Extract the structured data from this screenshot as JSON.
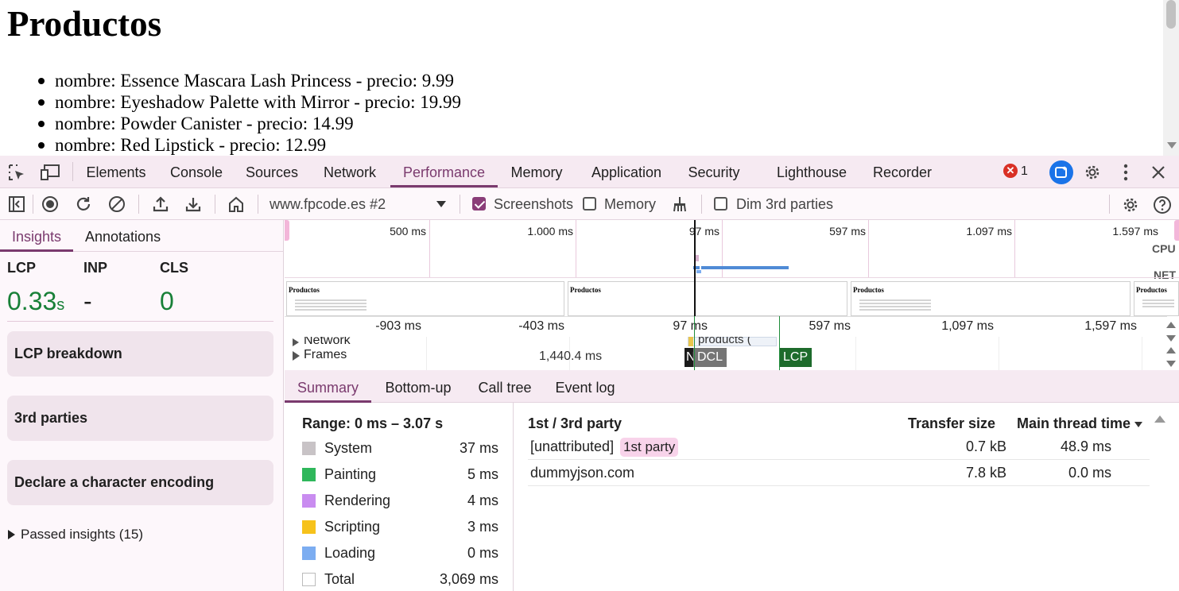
{
  "page": {
    "title": "Productos",
    "items": [
      "nombre: Essence Mascara Lash Princess - precio: 9.99",
      "nombre: Eyeshadow Palette with Mirror - precio: 19.99",
      "nombre: Powder Canister - precio: 14.99",
      "nombre: Red Lipstick - precio: 12.99"
    ]
  },
  "devtools": {
    "tabs": [
      "Elements",
      "Console",
      "Sources",
      "Network",
      "Performance",
      "Memory",
      "Application",
      "Security",
      "Lighthouse",
      "Recorder"
    ],
    "active_tab": "Performance",
    "error_count": "1",
    "toolbar": {
      "target": "www.fpcode.es #2",
      "screenshots_label": "Screenshots",
      "screenshots_checked": true,
      "memory_label": "Memory",
      "memory_checked": false,
      "dim_label": "Dim 3rd parties",
      "dim_checked": false
    }
  },
  "insights": {
    "tabs": [
      "Insights",
      "Annotations"
    ],
    "active_tab": "Insights",
    "metrics": [
      {
        "label": "LCP",
        "value": "0.33",
        "unit": "s",
        "color": "#188038"
      },
      {
        "label": "INP",
        "value": "-",
        "unit": "",
        "color": "#1f1f1f"
      },
      {
        "label": "CLS",
        "value": "0",
        "unit": "",
        "color": "#188038"
      }
    ],
    "cards": [
      "LCP breakdown",
      "3rd parties",
      "Declare a character encoding"
    ],
    "passed": "Passed insights (15)"
  },
  "timeline": {
    "overview_ticks": [
      "500 ms",
      "1.000 ms",
      "97 ms",
      "597 ms",
      "1.097 ms",
      "1.597 ms"
    ],
    "cpu_label": "CPU",
    "net_label": "NET",
    "ruler_ticks": [
      "-903 ms",
      "-403 ms",
      "97 ms",
      "597 ms",
      "1,097 ms",
      "1,597 ms"
    ],
    "tracks": {
      "network": "Network",
      "frames": "Frames",
      "frame_duration": "1,440.4 ms",
      "request_label": "products (",
      "markers": {
        "n": "N",
        "dcl": "DCL",
        "lcp": "LCP"
      }
    },
    "screenshot_title": "Productos"
  },
  "bottom": {
    "tabs": [
      "Summary",
      "Bottom-up",
      "Call tree",
      "Event log"
    ],
    "active_tab": "Summary",
    "range": "Range: 0 ms – 3.07 s",
    "categories": [
      {
        "name": "System",
        "value": "37 ms",
        "color": "#c8c3c6"
      },
      {
        "name": "Painting",
        "value": "5 ms",
        "color": "#2fb75b"
      },
      {
        "name": "Rendering",
        "value": "4 ms",
        "color": "#c98cf0"
      },
      {
        "name": "Scripting",
        "value": "3 ms",
        "color": "#f6c21b"
      },
      {
        "name": "Loading",
        "value": "0 ms",
        "color": "#7cadf1"
      },
      {
        "name": "Total",
        "value": "3,069 ms",
        "color": "#ffffff"
      }
    ],
    "party": {
      "header_party": "1st / 3rd party",
      "header_transfer": "Transfer size",
      "header_time": "Main thread time",
      "rows": [
        {
          "name": "[unattributed]",
          "badge": "1st party",
          "transfer": "0.7 kB",
          "time": "48.9 ms"
        },
        {
          "name": "dummyjson.com",
          "badge": "",
          "transfer": "7.8 kB",
          "time": "0.0 ms"
        }
      ]
    }
  }
}
